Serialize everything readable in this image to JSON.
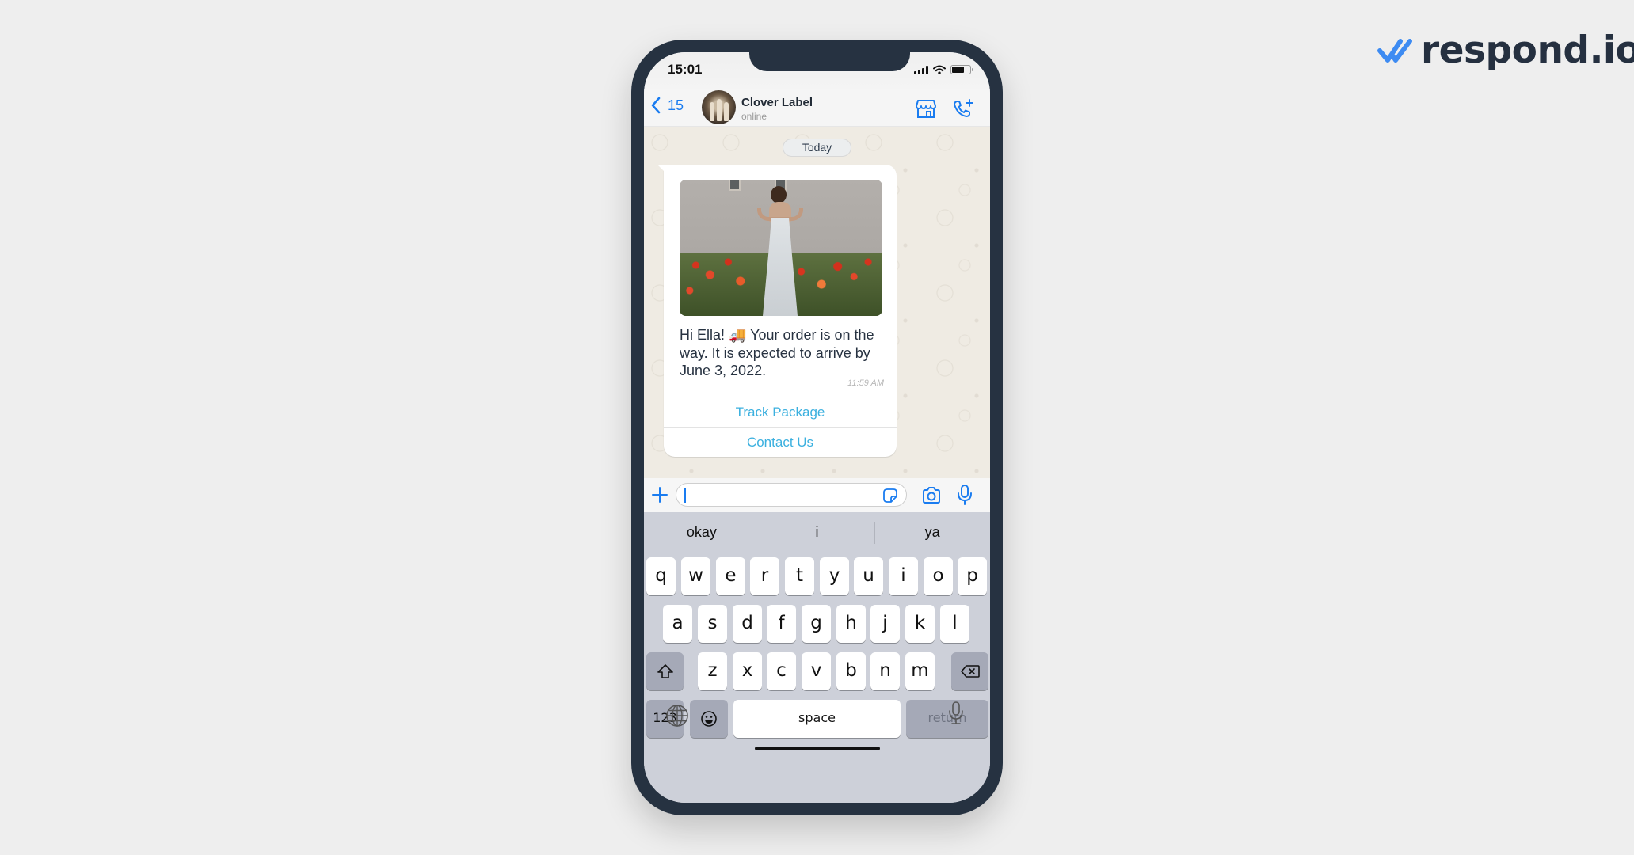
{
  "brand": {
    "name": "respond.io",
    "check_color": "#3d8bf2",
    "text_color": "#253040"
  },
  "status_bar": {
    "time": "15:01",
    "signal_bars": 4,
    "battery_level_percent": 70
  },
  "chat_header": {
    "back_count": "15",
    "contact_name": "Clover Label",
    "contact_status": "online",
    "icons": [
      "back-chevron-icon",
      "store-icon",
      "add-call-icon"
    ]
  },
  "chat": {
    "date_label": "Today",
    "message": {
      "image_alt": "Woman in white dress standing among red poppies",
      "text": "Hi Ella! 🚚 Your order is on the way. It is expected to arrive by June 3, 2022.",
      "time": "11:59 AM",
      "buttons": [
        {
          "label": "Track Package"
        },
        {
          "label": "Contact Us"
        }
      ]
    }
  },
  "composer": {
    "value": "",
    "placeholder": "",
    "icons": [
      "plus-icon",
      "sticker-icon",
      "camera-icon",
      "microphone-icon"
    ]
  },
  "keyboard": {
    "suggestions": [
      "okay",
      "i",
      "ya"
    ],
    "rows": [
      [
        "q",
        "w",
        "e",
        "r",
        "t",
        "y",
        "u",
        "i",
        "o",
        "p"
      ],
      [
        "a",
        "s",
        "d",
        "f",
        "g",
        "h",
        "j",
        "k",
        "l"
      ],
      [
        "z",
        "x",
        "c",
        "v",
        "b",
        "n",
        "m"
      ]
    ],
    "numbers_label": "123",
    "space_label": "space",
    "return_label": "return"
  },
  "colors": {
    "accent_blue": "#1a7cf0",
    "button_link": "#3bb0df",
    "phone_frame": "#263241",
    "chat_wallpaper": "#efebe3",
    "keyboard_bg": "#cdd0d9"
  }
}
